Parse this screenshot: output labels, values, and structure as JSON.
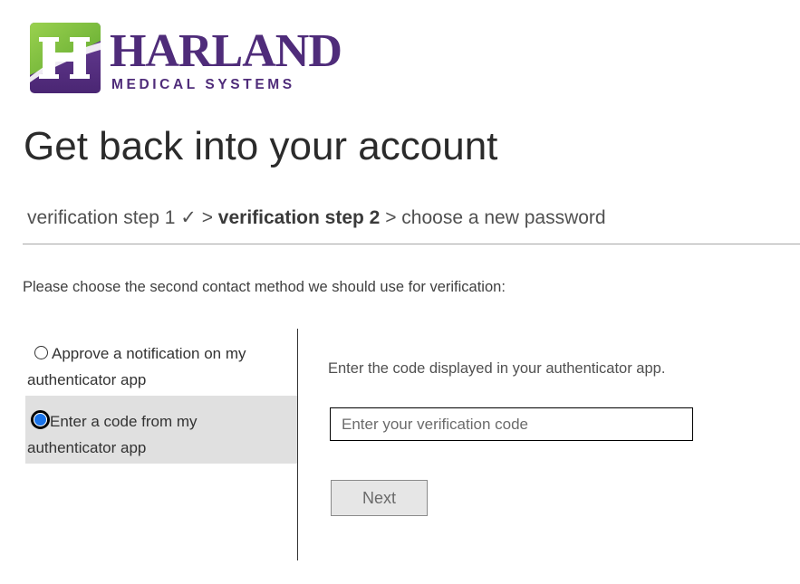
{
  "logo": {
    "name": "HARLAND",
    "tagline": "MEDICAL SYSTEMS",
    "mark_letter": "H"
  },
  "page": {
    "title": "Get back into your account"
  },
  "breadcrumb": {
    "step1": "verification step 1 ✓",
    "sep1": " > ",
    "step2": "verification step 2",
    "sep2": " > ",
    "step3": "choose a new password"
  },
  "instructions": "Please choose the second contact method we should use for verification:",
  "contact_methods": {
    "options": [
      {
        "label": "Approve a notification on my authenticator app",
        "selected": false
      },
      {
        "label": "Enter a code from my authenticator app",
        "selected": true
      }
    ]
  },
  "code_entry": {
    "prompt": "Enter the code displayed in your authenticator app.",
    "input_placeholder": "Enter your verification code",
    "input_value": "",
    "next_label": "Next"
  },
  "colors": {
    "brand_purple": "#4f2c7a",
    "brand_green": "#7dc242",
    "selected_row_bg": "#e0e0e0",
    "radio_accent": "#1a73e8"
  },
  "icons": {
    "completed_step": "checkmark-icon"
  }
}
